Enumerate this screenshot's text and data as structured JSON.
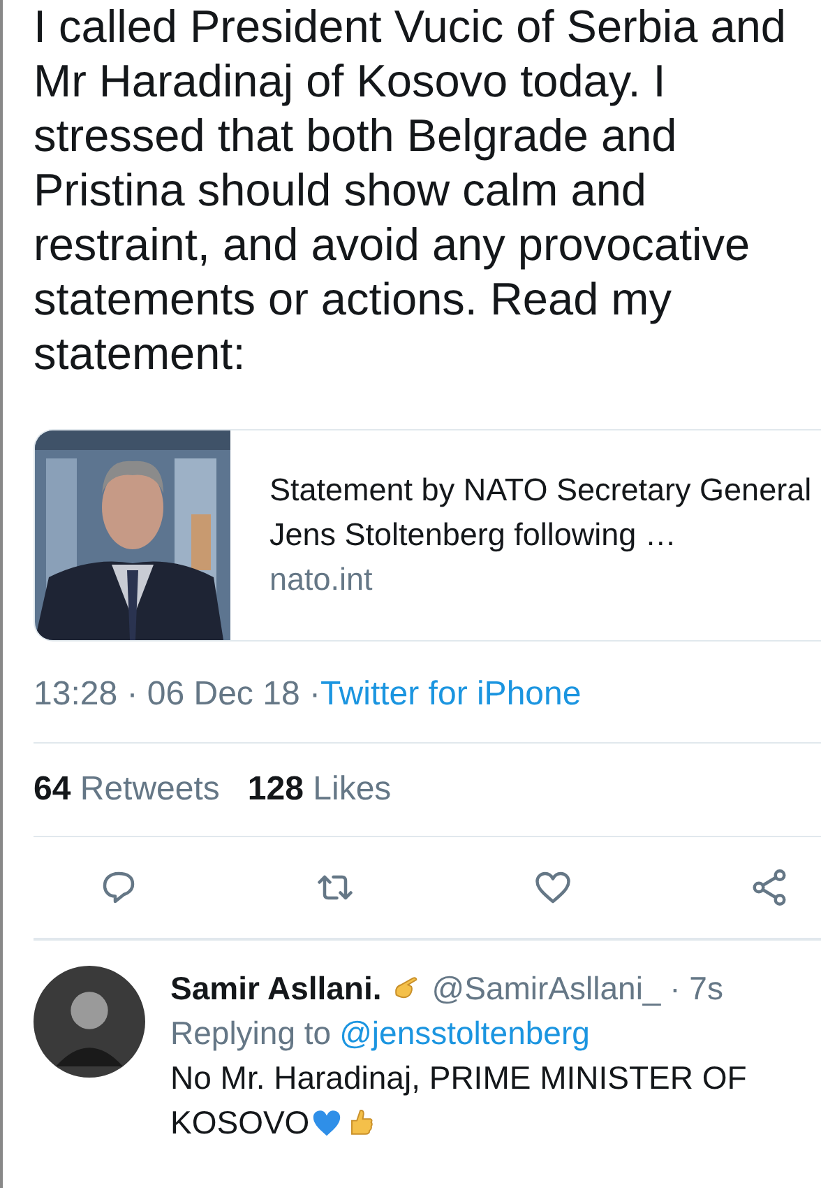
{
  "tweet": {
    "text": "I called President Vucic of Serbia and Mr Haradinaj of Kosovo today. I stressed that both Belgrade and Pristina should show calm and restraint, and avoid any provocative statements or actions. Read my statement:",
    "link_card": {
      "title": "Statement by NATO Secretary General Jens Stoltenberg following …",
      "domain": "nato.int"
    },
    "time": "13:28 · 06 Dec 18 ·",
    "source": "Twitter for iPhone",
    "stats": [
      {
        "count": "64",
        "label": "Retweets"
      },
      {
        "count": "128",
        "label": "Likes"
      }
    ],
    "actions": [
      {
        "kind": "reply"
      },
      {
        "kind": "retweet"
      },
      {
        "kind": "like"
      },
      {
        "kind": "share"
      }
    ]
  },
  "reply": {
    "name": "Samir Asllani.",
    "handle": "@SamirAsllani_ · 7s",
    "replying_label": "Replying to",
    "replying_to": "@jensstoltenberg",
    "text_lines": [
      "No Mr. Haradinaj, PRIME MINISTER OF",
      "KOSOVO"
    ]
  }
}
